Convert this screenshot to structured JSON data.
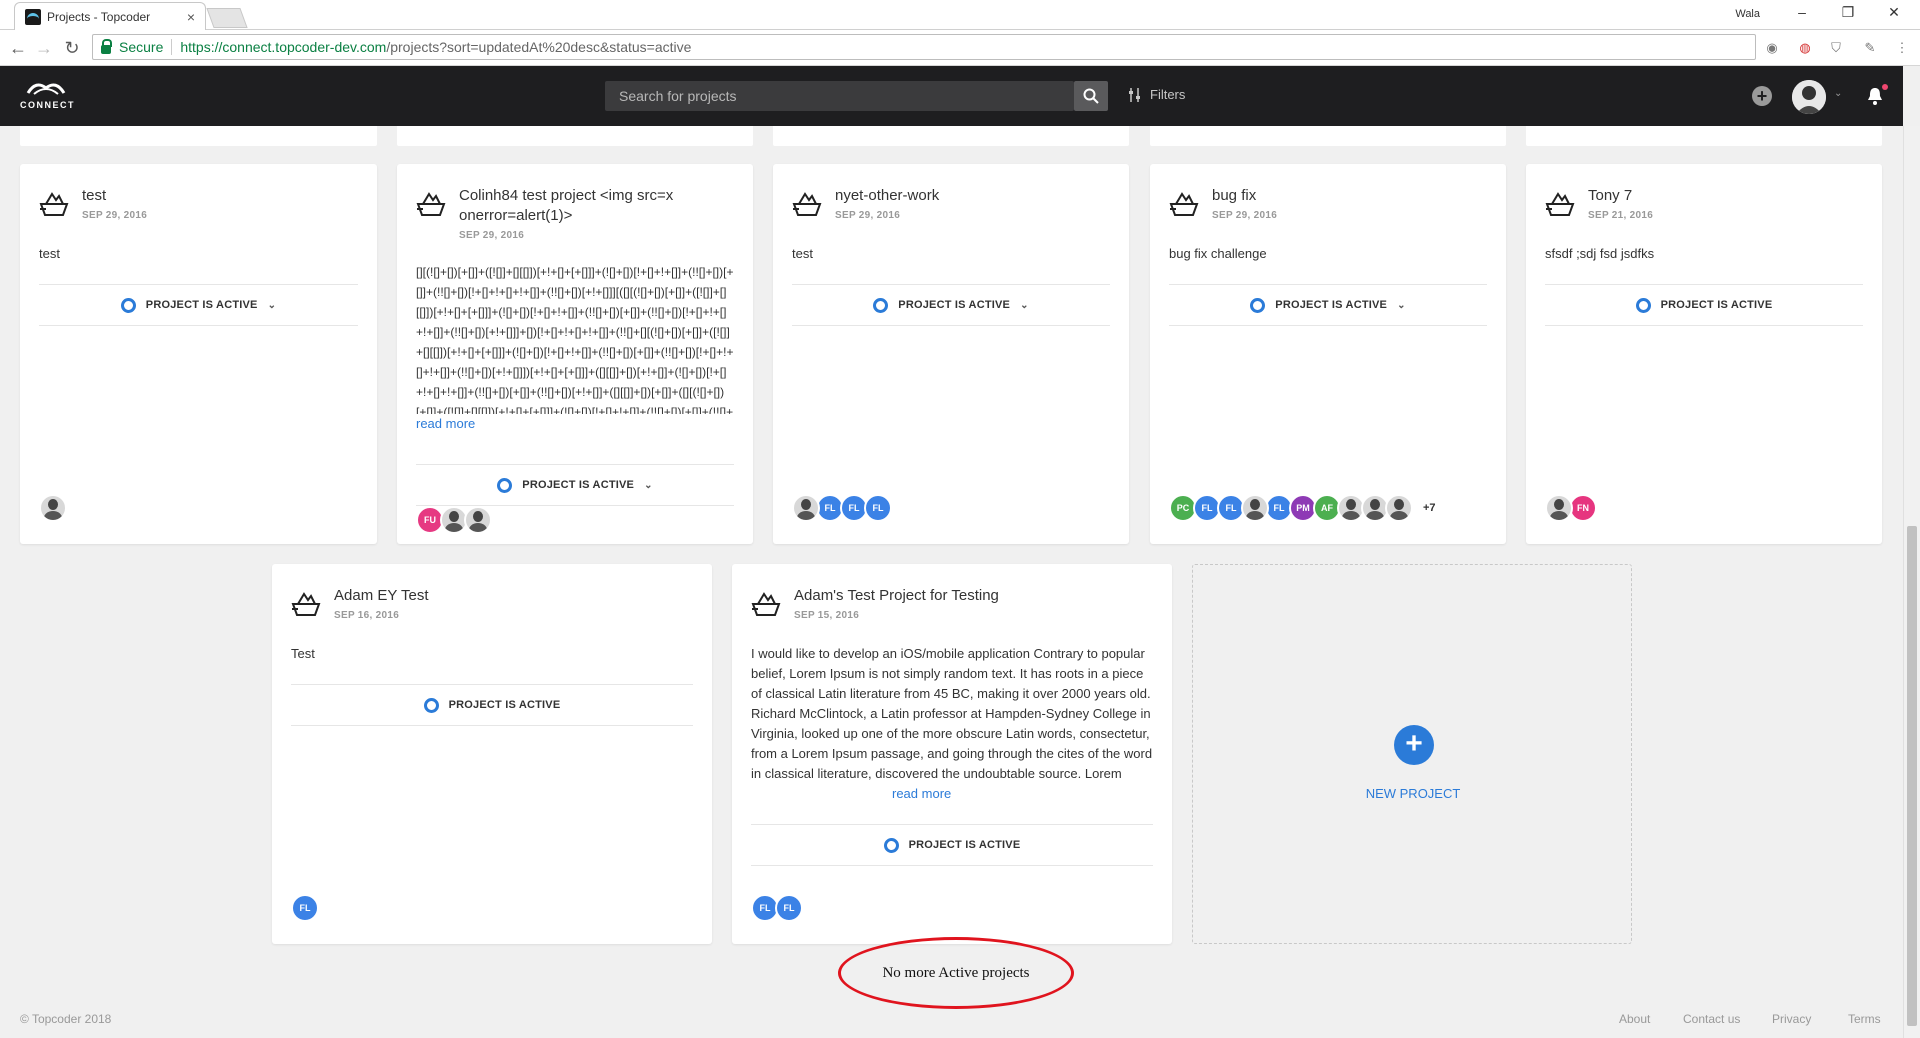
{
  "browser": {
    "tab_title": "Projects - Topcoder",
    "tab_close": "×",
    "user_name": "Wala",
    "secure_label": "Secure",
    "url_host": "https://connect.topcoder-dev.com",
    "url_path": "/projects?sort=updatedAt%20desc&status=active"
  },
  "header": {
    "logo_text": "CONNECT",
    "search_placeholder": "Search for projects",
    "filters_label": "Filters",
    "plus_label": "+",
    "chev": "⌄"
  },
  "colors": {
    "accent": "#2b7bd8",
    "header_bg": "#1e1e20",
    "annotation_red": "#e0141e"
  },
  "status_label": "PROJECT IS ACTIVE",
  "read_more_label": "read more",
  "cards_row1": [
    {
      "title": "test",
      "date": "SEP 29, 2016",
      "description": "test",
      "has_dropdown": true,
      "avatars": [
        {
          "type": "photo"
        }
      ]
    },
    {
      "title": "Colinh84 test project <img src=x onerror=alert(1)>",
      "date": "SEP 29, 2016",
      "description": "[][(![]+[])[+[]]+([![]]+[][[]])[+!+[]+[+[]]]+(![]+[])[!+[]+!+[]]+(!![]+[])[+[]]+(!![]+[])[!+[]+!+[]+!+[]]+(!![]+[])[+!+[]]][([][(![]+[])[+[]]+([![]]+[][[]])[+!+[]+[+[]]]+(![]+[])[!+[]+!+[]]+(!![]+[])[+[]]+(!![]+[])[!+[]+!+[]+!+[]]+(!![]+[])[+!+[]]]+[])[!+[]+!+[]+!+[]]+(!![]+[][(![]+[])[+[]]+([![]]+[][[]])[+!+[]+[+[]]]+(![]+[])[!+[]+!+[]]+(!![]+[])[+[]]+(!![]+[])[!+[]+!+[]+!+[]]+(!![]+[])[+!+[]]])[+!+[]+[+[]]]+([][[]]+[])[+!+[]]+(![]+[])[!+[]+!+[]+!+[]]+(!![]+[])[+[]]+(!![]+[])[+!+[]]+([][[]]+[])[+[]]+([][(![]+[])[+[]]+([![]]+[][[]])[+!+[]+[+[]]]+(![]+[])[!+[]+!+[]]+(!![]+[])[+[]]+(!![]+[])[!+[]+!+[]+!+[]]+(!![]+[])[+!+[]]]+[])[!+[]+!+[]+!+[]]+(!![]+[])[+[]]+(!![]+[][(![]+[])[+[]]+([![]]+[][[]])[+!+[]+[+[]]]+(![]+[])[!+[]+!+[]]+(!![]+[])[+[]]...",
      "has_dropdown": true,
      "avatars": [
        {
          "type": "initials",
          "text": "FU",
          "color": "#e63982"
        },
        {
          "type": "photo"
        },
        {
          "type": "photo"
        }
      ]
    },
    {
      "title": "nyet-other-work",
      "date": "SEP 29, 2016",
      "description": "test",
      "has_dropdown": true,
      "avatars": [
        {
          "type": "photo"
        },
        {
          "type": "initials",
          "text": "FL",
          "color": "#3b82e6"
        },
        {
          "type": "initials",
          "text": "FL",
          "color": "#3b82e6"
        },
        {
          "type": "initials",
          "text": "FL",
          "color": "#3b82e6"
        }
      ]
    },
    {
      "title": "bug fix",
      "date": "SEP 29, 2016",
      "description": "bug fix challenge",
      "has_dropdown": true,
      "avatars": [
        {
          "type": "initials",
          "text": "PC",
          "color": "#4caf50"
        },
        {
          "type": "initials",
          "text": "FL",
          "color": "#3b82e6"
        },
        {
          "type": "initials",
          "text": "FL",
          "color": "#3b82e6"
        },
        {
          "type": "photo"
        },
        {
          "type": "initials",
          "text": "FL",
          "color": "#3b82e6"
        },
        {
          "type": "initials",
          "text": "PM",
          "color": "#8e3ab5"
        },
        {
          "type": "initials",
          "text": "AF",
          "color": "#4caf50"
        },
        {
          "type": "photo"
        },
        {
          "type": "photo"
        },
        {
          "type": "photo"
        }
      ],
      "more": "+7"
    },
    {
      "title": "Tony 7",
      "date": "SEP 21, 2016",
      "description": "sfsdf ;sdj fsd jsdfks",
      "has_dropdown": false,
      "avatars": [
        {
          "type": "photo"
        },
        {
          "type": "initials",
          "text": "FN",
          "color": "#e6357f"
        }
      ]
    }
  ],
  "cards_row2": [
    {
      "title": "Adam EY Test",
      "date": "SEP 16, 2016",
      "description": "Test",
      "has_dropdown": false,
      "avatars": [
        {
          "type": "initials",
          "text": "FL",
          "color": "#3b82e6"
        }
      ]
    },
    {
      "title": "Adam's Test Project for Testing",
      "date": "SEP 15, 2016",
      "description": "I would like to develop an iOS/mobile application Contrary to popular belief, Lorem Ipsum is not simply random text. It has roots in a piece of classical Latin literature from 45 BC, making it over 2000 years old. Richard McClintock, a Latin professor at Hampden-Sydney College in Virginia, looked up one of the more obscure Latin words, consectetur, from a Lorem Ipsum passage, and going through the cites of the word in classical literature, discovered the undoubtable source. Lorem Ipsum comes from...",
      "has_dropdown": false,
      "avatars": [
        {
          "type": "initials",
          "text": "FL",
          "color": "#3b82e6"
        },
        {
          "type": "initials",
          "text": "FL",
          "color": "#3b82e6"
        }
      ]
    }
  ],
  "new_project": {
    "plus": "+",
    "label": "NEW PROJECT"
  },
  "no_more_text": "No more Active projects",
  "footer": {
    "copyright": "© Topcoder 2018",
    "links": [
      "About",
      "Contact us",
      "Privacy",
      "Terms"
    ]
  }
}
